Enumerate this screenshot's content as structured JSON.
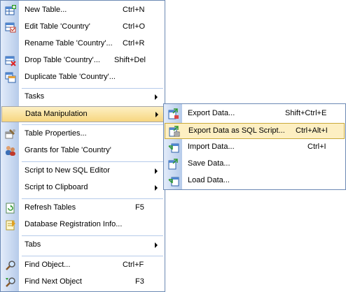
{
  "main_menu": {
    "items": [
      {
        "label": "New Table...",
        "shortcut": "Ctrl+N",
        "icon": "new-table-icon"
      },
      {
        "label": "Edit Table 'Country'",
        "shortcut": "Ctrl+O",
        "icon": "edit-table-icon"
      },
      {
        "label": "Rename Table 'Country'...",
        "shortcut": "Ctrl+R",
        "icon": ""
      },
      {
        "label": "Drop Table 'Country'...",
        "shortcut": "Shift+Del",
        "icon": "drop-table-icon"
      },
      {
        "label": "Duplicate Table 'Country'...",
        "shortcut": "",
        "icon": "duplicate-table-icon"
      },
      {
        "label": "Tasks",
        "shortcut": "",
        "icon": ""
      },
      {
        "label": "Data Manipulation",
        "shortcut": "",
        "icon": ""
      },
      {
        "label": "Table Properties...",
        "shortcut": "",
        "icon": "table-properties-icon"
      },
      {
        "label": "Grants for Table 'Country'",
        "shortcut": "",
        "icon": "grants-icon"
      },
      {
        "label": "Script to New SQL Editor",
        "shortcut": "",
        "icon": ""
      },
      {
        "label": "Script to Clipboard",
        "shortcut": "",
        "icon": ""
      },
      {
        "label": "Refresh Tables",
        "shortcut": "F5",
        "icon": "refresh-icon"
      },
      {
        "label": "Database Registration Info...",
        "shortcut": "",
        "icon": "registration-info-icon"
      },
      {
        "label": "Tabs",
        "shortcut": "",
        "icon": ""
      },
      {
        "label": "Find Object...",
        "shortcut": "Ctrl+F",
        "icon": "find-icon"
      },
      {
        "label": "Find Next Object",
        "shortcut": "F3",
        "icon": "find-next-icon"
      }
    ]
  },
  "submenu": {
    "items": [
      {
        "label": "Export Data...",
        "shortcut": "Shift+Ctrl+E",
        "icon": "export-data-icon"
      },
      {
        "label": "Export Data as SQL Script...",
        "shortcut": "Ctrl+Alt+I",
        "icon": "export-sql-icon"
      },
      {
        "label": "Import Data...",
        "shortcut": "Ctrl+I",
        "icon": "import-data-icon"
      },
      {
        "label": "Save Data...",
        "shortcut": "",
        "icon": "save-data-icon"
      },
      {
        "label": "Load Data...",
        "shortcut": "",
        "icon": "load-data-icon"
      }
    ]
  },
  "colors": {
    "gutter_light": "#e3ecfa",
    "gutter_dark": "#b6cbea",
    "border": "#6c89b4",
    "highlight": "#fdefc2"
  }
}
